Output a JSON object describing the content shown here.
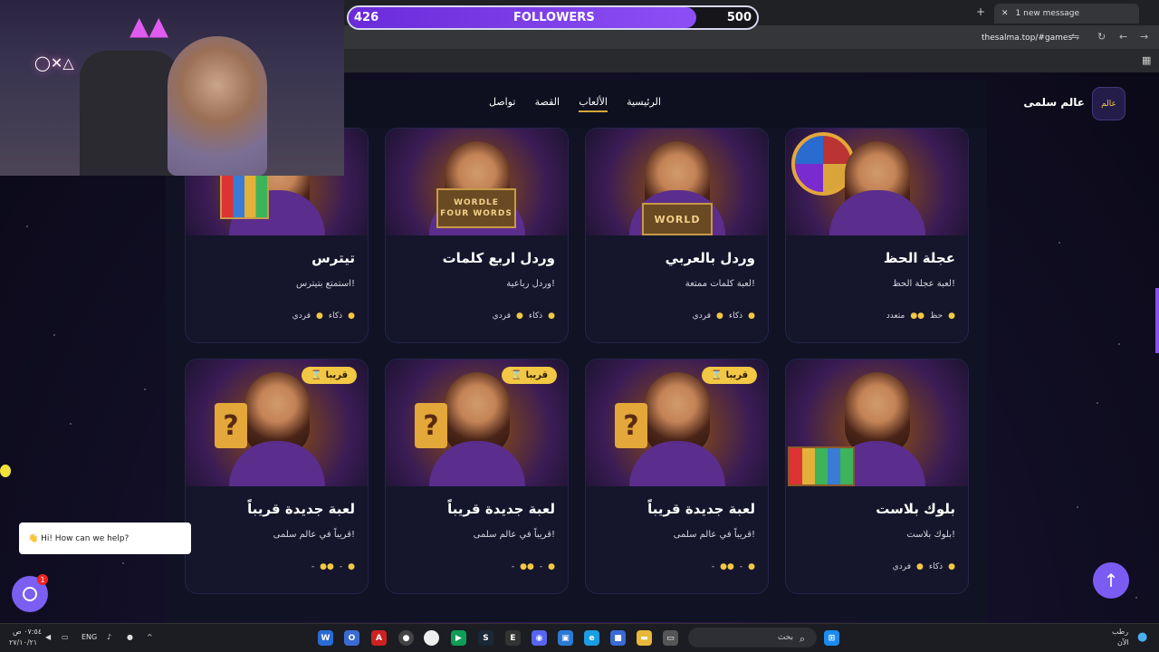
{
  "browser": {
    "tab_label": "1 new message",
    "url": "thesalma.top/#games"
  },
  "overlay": {
    "followers_label": "FOLLOWERS",
    "followers_current": "426",
    "followers_goal": "500",
    "followers_progress": 0.852
  },
  "site": {
    "name": "عالم سلمى",
    "logo_text": "عالم",
    "nav": [
      {
        "label": "الرئيسية",
        "active": false
      },
      {
        "label": "الألعاب",
        "active": true
      },
      {
        "label": "القصة",
        "active": false
      },
      {
        "label": "تواصل",
        "active": false
      }
    ]
  },
  "games_row1": [
    {
      "title": "عجلة الحظ",
      "desc": "لعبة عجلة الحظ!",
      "skill": "حظ",
      "players": "متعدد",
      "prop": "wheel"
    },
    {
      "title": "وردل بالعربي",
      "desc": "لعبة كلمات ممتعة!",
      "skill": "ذكاء",
      "players": "فردي",
      "prop": "WORLD"
    },
    {
      "title": "وردل اربع كلمات",
      "desc": "وردل رباعية!",
      "skill": "ذكاء",
      "players": "فردي",
      "prop": "WORDLE FOUR WORDS"
    },
    {
      "title": "تيترس",
      "desc": "استمتع بتيترس!",
      "skill": "ذكاء",
      "players": "فردي",
      "prop": "tetris"
    }
  ],
  "games_row2": [
    {
      "title": "بلوك بلاست",
      "desc": "بلوك بلاست!",
      "skill": "ذكاء",
      "players": "فردي",
      "badge": ""
    },
    {
      "title": "لعبة جديدة قريباً",
      "desc": "قريباً في عالم سلمى!",
      "skill": "-",
      "players": "-",
      "badge": "قريبا"
    },
    {
      "title": "لعبة جديدة قريباً",
      "desc": "قريباً في عالم سلمى!",
      "skill": "-",
      "players": "-",
      "badge": "قريبا"
    },
    {
      "title": "لعبة جديدة قريباً",
      "desc": "قريباً في عالم سلمى!",
      "skill": "-",
      "players": "-",
      "badge": "قريبا"
    }
  ],
  "chat": {
    "greeting": "👋 Hi! How can we help?",
    "unread": "1"
  },
  "taskbar": {
    "search_placeholder": "بحث",
    "lang": "ENG",
    "time": "٠٧:٥٤ ص",
    "date": "٢٧/١٠/٢١",
    "weather": "رطب",
    "weather_sub": "الآن"
  },
  "colors": {
    "accent": "#8d4ff5",
    "gold": "#f2c744",
    "card_bg": "#15162b"
  }
}
